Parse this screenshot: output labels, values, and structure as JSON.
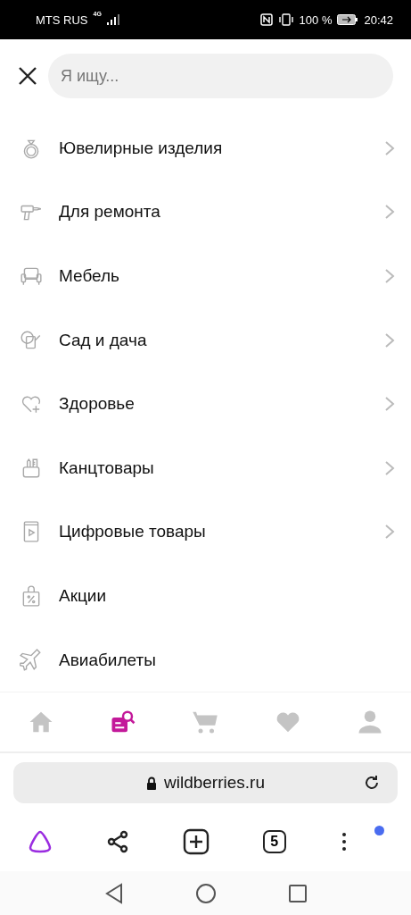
{
  "status_bar": {
    "carrier": "MTS RUS",
    "network": "4G",
    "battery": "100 %",
    "time": "20:42"
  },
  "search": {
    "placeholder": "Я ищу..."
  },
  "categories": [
    {
      "label": "Ювелирные изделия",
      "expandable": true
    },
    {
      "label": "Для ремонта",
      "expandable": true
    },
    {
      "label": "Мебель",
      "expandable": true
    },
    {
      "label": "Сад и дача",
      "expandable": true
    },
    {
      "label": "Здоровье",
      "expandable": true
    },
    {
      "label": "Канцтовары",
      "expandable": true
    },
    {
      "label": "Цифровые товары",
      "expandable": true
    },
    {
      "label": "Акции",
      "expandable": false
    },
    {
      "label": "Авиабилеты",
      "expandable": false
    }
  ],
  "bottom_nav": [
    {
      "selected": false
    },
    {
      "selected": true
    },
    {
      "selected": false
    },
    {
      "selected": false
    },
    {
      "selected": false
    }
  ],
  "browser": {
    "url": "wildberries.ru",
    "tab_count": "5",
    "menu_notification": true
  }
}
